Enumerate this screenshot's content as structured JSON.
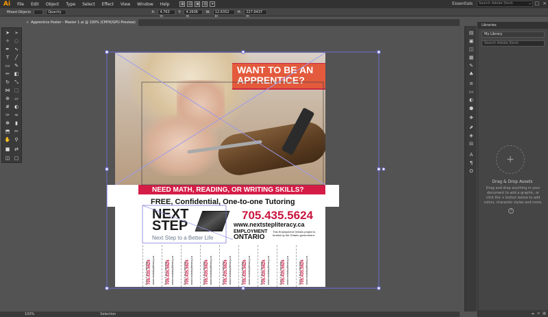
{
  "app": {
    "logo": "Ai",
    "menu": [
      "File",
      "Edit",
      "Object",
      "Type",
      "Select",
      "Effect",
      "View",
      "Window",
      "Help"
    ],
    "workspace": "Essentials",
    "stock_search_placeholder": "Search Adobe Stock"
  },
  "controlbar": {
    "selection_label": "Mixed Objects",
    "opacity_label": "Opacity",
    "x_value": "4.763 in",
    "y_value": "4.2606 in",
    "w_value": "12.6352 in",
    "h_value": "227.9437 in"
  },
  "document_tab": {
    "title": "Apprentice Poster - Master 1.ai @ 100% (CMYK/GPU Preview)",
    "close": "×"
  },
  "poster": {
    "headline_line1": "WANT TO BE AN",
    "headline_line2": "APPRENTICE?",
    "skills_banner": "NEED MATH, READING, OR WRITING SKILLS?",
    "tutoring": "FREE, Confidential, One-to-one Tutoring",
    "logo_next": "NEXT",
    "logo_step": "STEP",
    "logo_tagline": "Next Step to a Better Life",
    "phone": "705.435.5624",
    "website": "www.nextstepliteracy.ca",
    "eo_line1": "EMPLOYMENT",
    "eo_line2": "ONTARIO",
    "funded_note": "This Employment Ontario project is funded by the Ontario government.",
    "tear_tabs": [
      {
        "line1": "Free 1-to-1 tutoring",
        "phone": "705.435.5624",
        "web": "www.nextstepliteracy.ca"
      },
      {
        "line1": "Free 1-to-1 tutoring",
        "phone": "705.435.5624",
        "web": "www.nextstepliteracy.ca"
      },
      {
        "line1": "Free 1-to-1 tutoring",
        "phone": "705.435.5624",
        "web": "www.nextstepliteracy.ca"
      },
      {
        "line1": "Free 1-to-1 tutoring",
        "phone": "705.435.5624",
        "web": "www.nextstepliteracy.ca"
      },
      {
        "line1": "Free 1-to-1 tutoring",
        "phone": "705.435.5624",
        "web": "www.nextstepliteracy.ca"
      },
      {
        "line1": "Free 1-to-1 tutoring",
        "phone": "705.435.5624",
        "web": "www.nextstepliteracy.ca"
      },
      {
        "line1": "Free 1-to-1 tutoring",
        "phone": "705.435.5624",
        "web": "www.nextstepliteracy.ca"
      },
      {
        "line1": "Free 1-to-1 tutoring",
        "phone": "705.435.5624",
        "web": "www.nextstepliteracy.ca"
      },
      {
        "line1": "Free 1-to-1 tutoring",
        "phone": "705.435.5624",
        "web": "www.nextstepliteracy.ca"
      }
    ]
  },
  "statusbar": {
    "zoom": "100%",
    "tool": "Selection"
  },
  "libraries": {
    "panel_title": "Libraries",
    "library_name": "My Library",
    "search_placeholder": "Search Adobe Stock",
    "drop_title": "Drag & Drop Assets",
    "drop_desc": "Drag and drop anything in your document to add a graphic, or click the + button below to add colors, character styles and more.",
    "plus": "+",
    "help": "?"
  },
  "colors": {
    "brand_red": "#d51c47",
    "headline_orange": "#e35a3c",
    "phone_red": "#c8163f",
    "selection_blue": "#6b6bd6"
  }
}
